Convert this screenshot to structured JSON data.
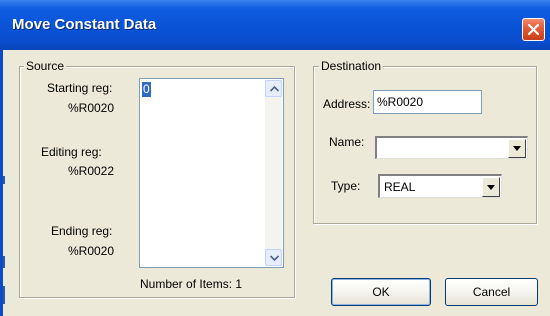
{
  "window": {
    "title": "Move Constant Data",
    "close_icon": "close-icon"
  },
  "source": {
    "group_label": "Source",
    "starting_reg_label": "Starting reg:",
    "starting_reg_value": "%R0020",
    "editing_reg_label": "Editing reg:",
    "editing_reg_value": "%R0022",
    "ending_reg_label": "Ending reg:",
    "ending_reg_value": "%R0020",
    "list_items": [
      "0"
    ],
    "number_of_items_text": "Number of Items: 1"
  },
  "destination": {
    "group_label": "Destination",
    "address_label": "Address:",
    "address_value": "%R0020",
    "name_label": "Name:",
    "name_value": "",
    "type_label": "Type:",
    "type_value": "REAL"
  },
  "buttons": {
    "ok_label": "OK",
    "cancel_label": "Cancel"
  },
  "colors": {
    "titlebar": "#0a4ccb",
    "dialog_background": "#ece9d8",
    "selection": "#316ac5",
    "close_button": "#e15a33"
  }
}
